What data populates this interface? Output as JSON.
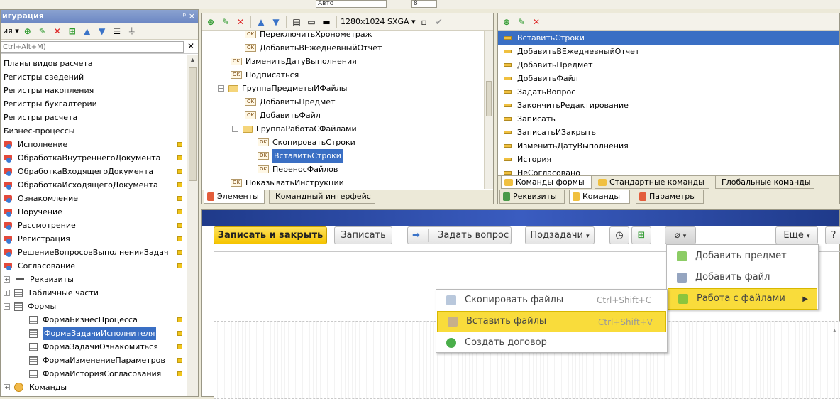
{
  "top_toolbar": {
    "font_field": "Авто",
    "size_field": "8"
  },
  "left_panel": {
    "title": "игурация",
    "pin": "ᵖ ×",
    "actions_label": "ия ▾",
    "search_placeholder": "Ctrl+Alt+M)",
    "items": [
      {
        "label": "Планы видов расчета",
        "indent": 0,
        "icon": "none"
      },
      {
        "label": "Регистры сведений",
        "indent": 0,
        "icon": "none"
      },
      {
        "label": "Регистры накопления",
        "indent": 0,
        "icon": "none"
      },
      {
        "label": "Регистры бухгалтерии",
        "indent": 0,
        "icon": "none"
      },
      {
        "label": "Регистры расчета",
        "indent": 0,
        "icon": "none"
      },
      {
        "label": "Бизнес-процессы",
        "indent": 0,
        "icon": "none"
      },
      {
        "label": "Исполнение",
        "indent": 0,
        "icon": "bp",
        "marker": true
      },
      {
        "label": "ОбработкаВнутреннегоДокумента",
        "indent": 0,
        "icon": "bp",
        "marker": true
      },
      {
        "label": "ОбработкаВходящегоДокумента",
        "indent": 0,
        "icon": "bp",
        "marker": true
      },
      {
        "label": "ОбработкаИсходящегоДокумента",
        "indent": 0,
        "icon": "bp",
        "marker": true
      },
      {
        "label": "Ознакомление",
        "indent": 0,
        "icon": "bp",
        "marker": true
      },
      {
        "label": "Поручение",
        "indent": 0,
        "icon": "bp",
        "marker": true
      },
      {
        "label": "Рассмотрение",
        "indent": 0,
        "icon": "bp",
        "marker": true
      },
      {
        "label": "Регистрация",
        "indent": 0,
        "icon": "bp",
        "marker": true
      },
      {
        "label": "РешениеВопросовВыполненияЗадач",
        "indent": 0,
        "icon": "bp",
        "marker": true
      },
      {
        "label": "Согласование",
        "indent": 0,
        "icon": "bp",
        "marker": true
      },
      {
        "label": "Реквизиты",
        "indent": 1,
        "icon": "attr",
        "pm": "+"
      },
      {
        "label": "Табличные части",
        "indent": 1,
        "icon": "table",
        "pm": "+"
      },
      {
        "label": "Формы",
        "indent": 1,
        "icon": "forms",
        "pm": "−"
      },
      {
        "label": "ФормаБизнесПроцесса",
        "indent": 2,
        "icon": "form",
        "marker": true
      },
      {
        "label": "ФормаЗадачиИсполнителя",
        "indent": 2,
        "icon": "form",
        "marker": true,
        "selected": true
      },
      {
        "label": "ФормаЗадачиОзнакомиться",
        "indent": 2,
        "icon": "form",
        "marker": true
      },
      {
        "label": "ФормаИзменениеПараметров",
        "indent": 2,
        "icon": "form",
        "marker": true
      },
      {
        "label": "ФормаИсторияСогласования",
        "indent": 2,
        "icon": "form",
        "marker": true
      },
      {
        "label": "Команды",
        "indent": 1,
        "icon": "cmds",
        "pm": "+"
      }
    ]
  },
  "elements_panel": {
    "resolution": "1280x1024 SXGA",
    "items": [
      {
        "label": "ПереключитьХронометраж",
        "level": 2,
        "icon": "ok"
      },
      {
        "label": "ДобавитьВЕжедневныйОтчет",
        "level": 2,
        "icon": "ok"
      },
      {
        "label": "ИзменитьДатуВыполнения",
        "level": 1,
        "icon": "ok"
      },
      {
        "label": "Подписаться",
        "level": 1,
        "icon": "ok"
      },
      {
        "label": "ГруппаПредметыИФайлы",
        "level": 1,
        "icon": "folder",
        "pm": "−"
      },
      {
        "label": "ДобавитьПредмет",
        "level": 2,
        "icon": "ok"
      },
      {
        "label": "ДобавитьФайл",
        "level": 2,
        "icon": "ok"
      },
      {
        "label": "ГруппаРаботаСФайлами",
        "level": 2,
        "icon": "folder",
        "pm": "−"
      },
      {
        "label": "СкопироватьСтроки",
        "level": 3,
        "icon": "ok"
      },
      {
        "label": "ВставитьСтроки",
        "level": 3,
        "icon": "ok",
        "selected": true
      },
      {
        "label": "ПереносФайлов",
        "level": 3,
        "icon": "ok"
      },
      {
        "label": "ПоказыватьИнструкции",
        "level": 1,
        "icon": "ok"
      }
    ],
    "tabs": [
      "Элементы",
      "Командный интерфейс"
    ]
  },
  "commands_panel": {
    "items": [
      {
        "label": "ВставитьСтроки",
        "selected": true
      },
      {
        "label": "ДобавитьВЕжедневныйОтчет"
      },
      {
        "label": "ДобавитьПредмет"
      },
      {
        "label": "ДобавитьФайл"
      },
      {
        "label": "ЗадатьВопрос"
      },
      {
        "label": "ЗакончитьРедактирование"
      },
      {
        "label": "Записать"
      },
      {
        "label": "ЗаписатьИЗакрыть"
      },
      {
        "label": "ИзменитьДатуВыполнения"
      },
      {
        "label": "История"
      },
      {
        "label": "НеСогласовано"
      }
    ],
    "subtabs": [
      "Команды формы",
      "Стандартные команды",
      "Глобальные команды"
    ],
    "tabs": [
      "Реквизиты",
      "Команды",
      "Параметры"
    ]
  },
  "form_preview": {
    "buttons": {
      "save_close": "Записать и закрыть",
      "save": "Записать",
      "ask": "Задать вопрос",
      "subtasks": "Подзадачи",
      "more": "Еще",
      "help": "?"
    },
    "attach_menu": [
      {
        "label": "Добавить предмет"
      },
      {
        "label": "Добавить файл"
      },
      {
        "label": "Работа с файлами",
        "submenu": true,
        "highlighted": true
      }
    ],
    "files_menu": [
      {
        "label": "Скопировать файлы",
        "shortcut": "Ctrl+Shift+C"
      },
      {
        "label": "Вставить файлы",
        "shortcut": "Ctrl+Shift+V",
        "highlighted": true
      },
      {
        "label": "Создать договор",
        "shortcut": ""
      }
    ]
  }
}
